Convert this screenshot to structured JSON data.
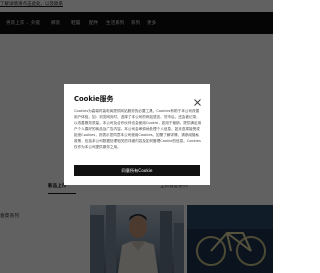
{
  "topbar": {
    "text": "了解详情请点击此处，以及联系"
  },
  "navbar": {
    "items": [
      {
        "label": "男装上衣",
        "chevron": "⌄"
      },
      {
        "label": "外套"
      },
      {
        "label": "裤装"
      },
      {
        "label": "鞋履"
      },
      {
        "label": "配件"
      },
      {
        "label": "生活系列"
      },
      {
        "label": "系列"
      },
      {
        "label": "更多"
      }
    ]
  },
  "tabs": [
    {
      "label": "新品上市",
      "active": true
    },
    {
      "label": "全新春夏系列",
      "active": false
    }
  ],
  "side_label": "春夏系列",
  "cookie_dialog": {
    "title": "Cookie服务",
    "body": "Cookies为高端时装电商提供网站服务的必要工具，Cookies有助于本公司改善用户体验，如：浏览网页时、选择了本公司的网站语言、货币后，还会被记录，以改善服务质量。本公司及合作伙伴也会使用Cookie，如用于营销，提供满足用户个人喜好的商品及广告内容。本公司会审慎地处理个人信息。如未选择接受或拒绝Cookies，则表示您同意本公司使用Cookies。如需了解详情，请参阅隐私政策，包括本公司数据处理相关的详细内容及如何管理Cookie的信息。Cookies仅作为本公司提供服务之用。",
    "accept_label": "同意所有Cookie",
    "close_icon": "close-icon"
  },
  "colors": {
    "nav_bg": "#0e0e0e",
    "overlay": "rgba(0,0,0,0.62)",
    "button_bg": "#111111"
  }
}
